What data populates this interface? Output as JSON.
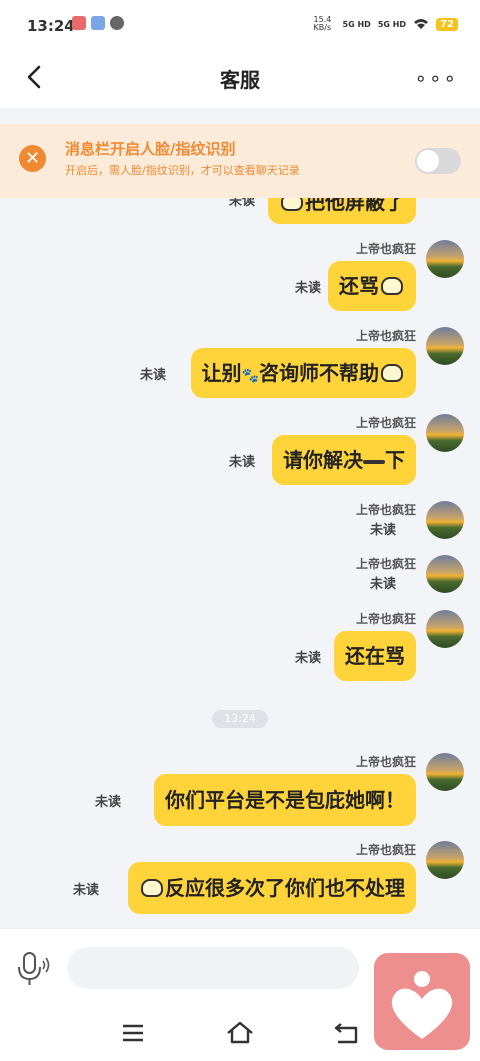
{
  "status_bar": {
    "time": "13:24",
    "net_speed": "15.4 KB/s",
    "sim1": "5G HD",
    "sim2": "5G HD",
    "battery": "72"
  },
  "nav": {
    "title": "客服",
    "more_label": "∘∘∘"
  },
  "banner": {
    "title": "消息栏开启人脸/指纹识别",
    "subtitle": "开启后，需人脸/指纹识别，才可以查看聊天记录",
    "toggle_on": false,
    "color": "#f08a32"
  },
  "messages": {
    "partial": {
      "text": "把他屏蔽了",
      "unread": "未读"
    },
    "m1": {
      "sender": "上帝也疯狂",
      "text": "还骂",
      "unread": "未读"
    },
    "m2": {
      "sender": "上帝也疯狂",
      "pre": "让别",
      "post": "咨询师不帮助",
      "unread": "未读"
    },
    "m3": {
      "sender": "上帝也疯狂",
      "pre": "请你解决",
      "post": "下",
      "unread": "未读"
    },
    "m4": {
      "sender": "上帝也疯狂",
      "unread": "未读"
    },
    "m5": {
      "sender": "上帝也疯狂",
      "unread": "未读"
    },
    "m6": {
      "sender": "上帝也疯狂",
      "text": "还在骂",
      "unread": "未读"
    },
    "time_divider": "13:24",
    "m7": {
      "sender": "上帝也疯狂",
      "text": "你们平台是不是包庇她啊！",
      "unread": "未读"
    },
    "m8": {
      "sender": "上帝也疯狂",
      "text": "反应很多次了你们也不处理",
      "unread": "未读"
    }
  },
  "colors": {
    "bubble": "#ffd43b",
    "chat_bg": "#f3f4f7",
    "accent": "#f08a32"
  },
  "input": {
    "placeholder": ""
  },
  "icons": [
    "back-icon",
    "more-icon",
    "close-icon",
    "mic-icon",
    "menu-icon",
    "home-icon",
    "return-icon",
    "heart-icon",
    "cat-emoji-icon",
    "paw-emoji-icon"
  ]
}
